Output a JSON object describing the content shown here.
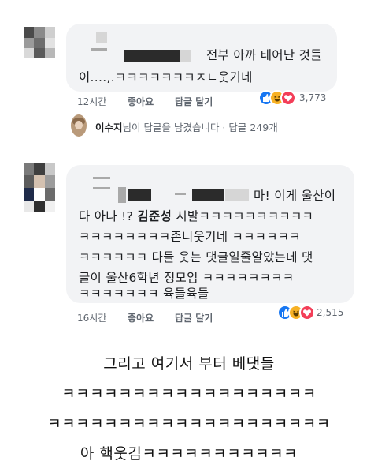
{
  "comment1": {
    "line1": "전부 아까 태어난 것들",
    "line2": "이....,.ㅋㅋㅋㅋㅋㅋㅋㅈㄴ웃기네",
    "time": "12시간",
    "like_label": "좋아요",
    "reply_label": "답글 달기",
    "reaction_count": "3,773"
  },
  "reply_summary": {
    "name": "이수지",
    "text": "님이 답글을 남겼습니다 · 답글 249개"
  },
  "comment2": {
    "line1_tail": "마! 이게 울산이",
    "line2_prefix": "다 아나 !?",
    "line2_name": "김준성",
    "line2_rest": "시발ㅋㅋㅋㅋㅋㅋㅋㅋㅋㅋ",
    "line3": "ㅋㅋㅋㅋㅋㅋㅋㅋ존니웃기네 ㅋㅋㅋㅋㅋㅋ",
    "line4": "ㅋㅋㅋㅋㅋㅋ 다들 웃는 댓글일줄알았는데 댓",
    "line5": "글이 울산6학년 정모임 ㅋㅋㅋㅋㅋㅋㅋㅋ",
    "line6": "ㅋㅋㅋㅋㅋㅋㅋ 육들육들",
    "time": "16시간",
    "like_label": "좋아요",
    "reply_label": "답글 달기",
    "reaction_count": "2,515"
  },
  "caption": {
    "line1": "그리고 여기서 부터 베댓들",
    "line2": "ㅋㅋㅋㅋㅋㅋㅋㅋㅋㅋㅋㅋㅋㅋㅋㅋㅋㅋ",
    "line3": "ㅋㅋㅋㅋㅋㅋㅋㅋㅋㅋㅋㅋㅋㅋㅋㅋㅋㅋㅋㅋ",
    "line4": "아 핵웃김ㅋㅋㅋㅋㅋㅋㅋㅋㅋㅋㅋ"
  },
  "icons": {
    "like": "thumbs-up-icon",
    "haha": "laughing-face-icon",
    "love": "heart-icon"
  },
  "colors": {
    "bubble": "#f2f3f5",
    "like": "#1877f2",
    "haha": "#f7b125",
    "love": "#f33e58",
    "meta": "#606770"
  }
}
